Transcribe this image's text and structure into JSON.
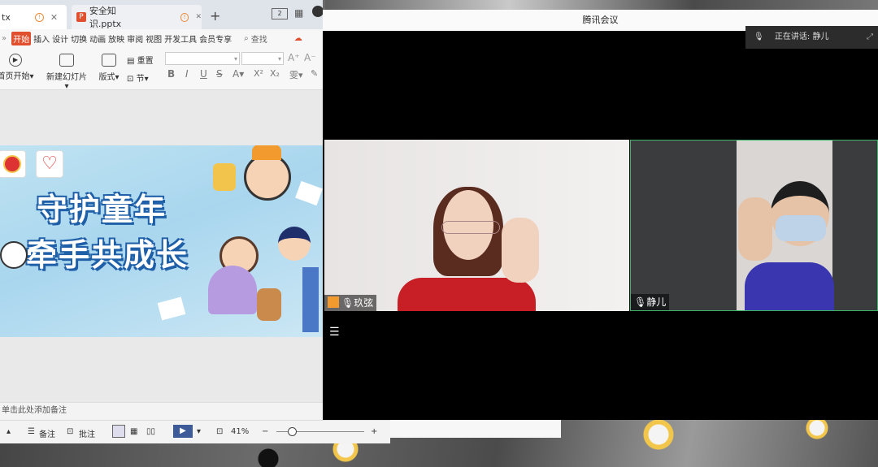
{
  "wps": {
    "tabs": [
      {
        "label": "tx"
      },
      {
        "label": "安全知识.pptx"
      }
    ],
    "new_tab": "+",
    "menu": [
      "开始",
      "插入",
      "设计",
      "切换",
      "动画",
      "放映",
      "审阅",
      "视图",
      "开发工具",
      "会员专享"
    ],
    "search_label": "查找",
    "ribbon": {
      "from_current": "首页开始",
      "new_slide": "新建幻灯片",
      "layout": "版式",
      "section": "节",
      "reset": "重置"
    },
    "slide": {
      "title_line1": "守护童年",
      "title_line2": "牵手共成长"
    },
    "notes_placeholder": "单击此处添加备注",
    "status": {
      "notes": "备注",
      "comments": "批注",
      "zoom": "41%"
    }
  },
  "meeting": {
    "window_title": "腾讯会议",
    "speaking_label": "正在讲话: 静儿",
    "participants": [
      {
        "name": "玖弦"
      },
      {
        "name": "静儿"
      }
    ]
  },
  "colors": {
    "wps_accent": "#e0502f",
    "active_speaker_border": "#3bb36a",
    "host_badge": "#f29a2e"
  }
}
